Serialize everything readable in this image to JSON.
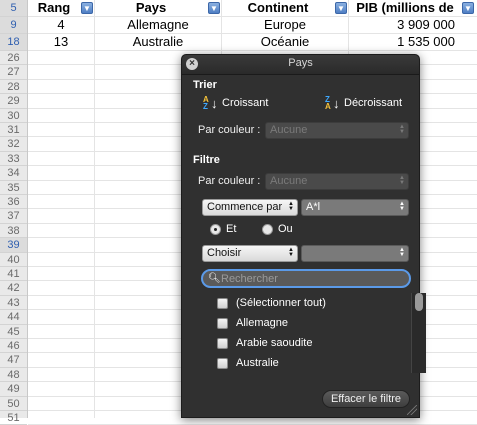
{
  "sheet": {
    "headers": [
      {
        "label": "Rang",
        "filter_icon": "dropdown-arrow"
      },
      {
        "label": "Pays",
        "filter_icon": "funnel"
      },
      {
        "label": "Continent",
        "filter_icon": "dropdown-arrow"
      },
      {
        "label": "PIB (millions de",
        "filter_icon": "dropdown-arrow"
      }
    ],
    "rows": [
      {
        "row": "9",
        "rang": "4",
        "pays": "Allemagne",
        "continent": "Europe",
        "pib": "3 909 000"
      },
      {
        "row": "18",
        "rang": "13",
        "pays": "Australie",
        "continent": "Océanie",
        "pib": "1 535 000"
      }
    ],
    "header_row_number": "5",
    "empty_row_numbers": [
      "26",
      "27",
      "28",
      "29",
      "30",
      "31",
      "32",
      "33",
      "34",
      "35",
      "36",
      "37",
      "38",
      "39",
      "40",
      "41",
      "42",
      "43",
      "44",
      "45",
      "46",
      "47",
      "48",
      "49",
      "50",
      "51"
    ],
    "highlighted_row_numbers": [
      "5",
      "9",
      "18",
      "39"
    ]
  },
  "popup": {
    "title": "Pays",
    "sort": {
      "section_label": "Trier",
      "ascending_label": "Croissant",
      "descending_label": "Décroissant",
      "color_label": "Par couleur :",
      "color_value": "Aucune"
    },
    "filter": {
      "section_label": "Filtre",
      "color_label": "Par couleur :",
      "color_value": "Aucune",
      "condition1_operator": "Commence par",
      "condition1_value": "A*l",
      "and_label": "Et",
      "or_label": "Ou",
      "selected_logic": "Et",
      "condition2_operator": "Choisir",
      "condition2_value": ""
    },
    "search_placeholder": "Rechercher",
    "list_items": [
      "(Sélectionner tout)",
      "Allemagne",
      "Arabie saoudite",
      "Australie"
    ],
    "clear_label": "Effacer le filtre"
  }
}
